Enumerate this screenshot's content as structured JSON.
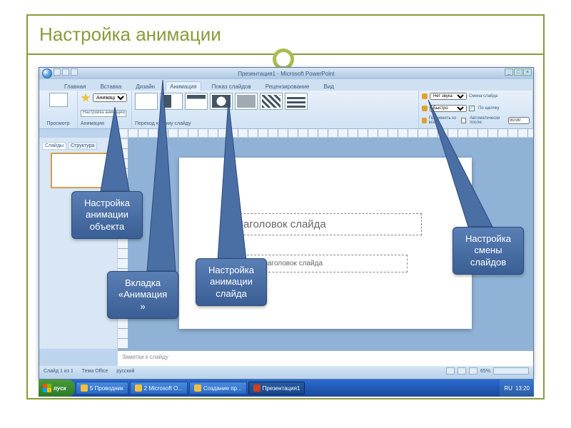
{
  "slide": {
    "title": "Настройка анимации"
  },
  "powerpoint": {
    "window_title": "Презентация1 - Microsoft PowerPoint",
    "tabs": {
      "home": "Главная",
      "insert": "Вставка",
      "design": "Дизайн",
      "animation": "Анимация",
      "slideshow": "Показ слайдов",
      "review": "Рецензирование",
      "view": "Вид"
    },
    "ribbon": {
      "preview_btn": "Просмотр",
      "preview_group": "Просмотр",
      "anim_select": "Анимация",
      "custom_anim_btn": "Настройка анимации",
      "anim_group": "Анимация",
      "sound_label": "Нет звука",
      "speed_label": "Быстро",
      "apply_all": "Применить ко всем",
      "advance_label": "Смена слайда",
      "on_click": "По щелчку",
      "auto_after": "Автоматически после:",
      "auto_time": "00:00",
      "trans_group": "Переход к этому слайду"
    },
    "left_tabs": {
      "slides": "Слайды",
      "outline": "Структура"
    },
    "canvas": {
      "title_ph": "Заголовок слайда",
      "subtitle_ph": "Подзаголовок слайда"
    },
    "notes": "Заметки к слайду",
    "status": {
      "slide": "Слайд 1 из 1",
      "theme": "Тема Office",
      "lang": "русский",
      "zoom": "65%"
    }
  },
  "callouts": {
    "c1": "Настройка\nанимации\nобъекта",
    "c2": "Вкладка\n«Анимация\n»",
    "c3": "Настройка\nанимации\nслайда",
    "c4": "Настройка\nсмены\nслайдов"
  },
  "taskbar": {
    "start": "пуск",
    "items": [
      "5 Проводник",
      "2 Microsoft O...",
      "Создание пр...",
      "Презентация1"
    ],
    "lang": "RU",
    "time": "13:20"
  }
}
